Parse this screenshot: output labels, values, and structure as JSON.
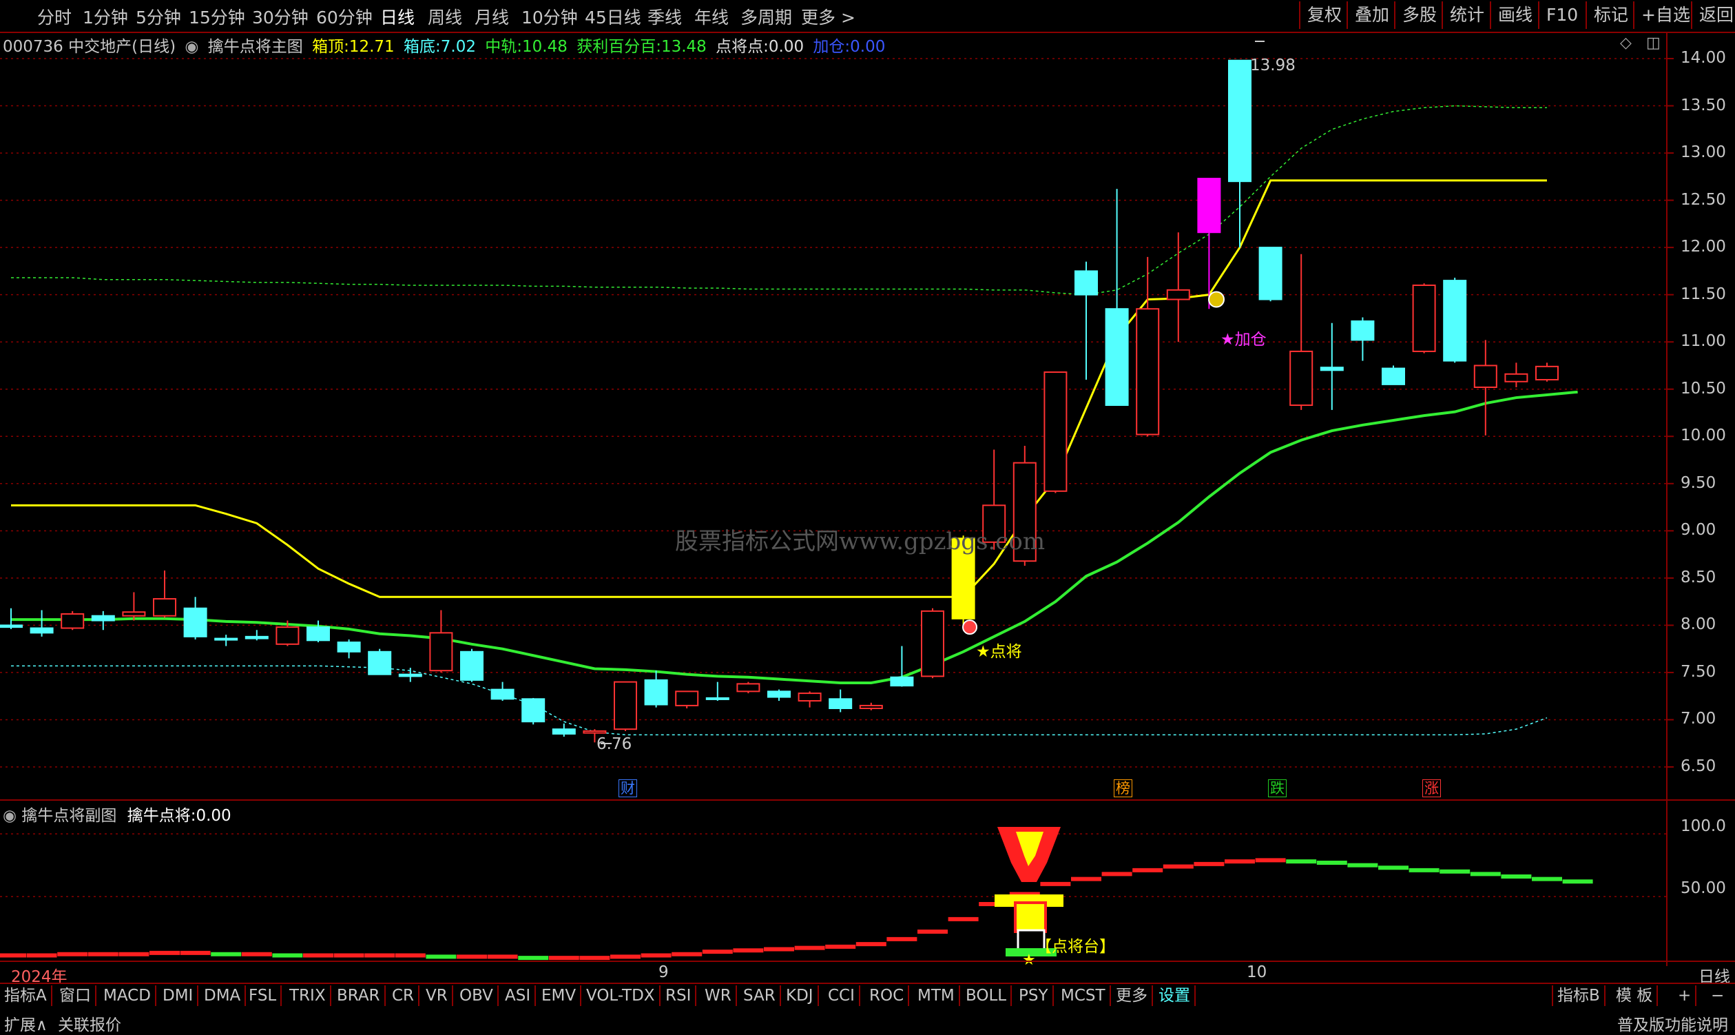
{
  "topbar": {
    "periods": [
      "分时",
      "1分钟",
      "5分钟",
      "15分钟",
      "30分钟",
      "60分钟",
      "日线",
      "周线",
      "月线",
      "10分钟",
      "45日线",
      "季线",
      "年线",
      "多周期",
      "更多 >"
    ],
    "active_period": "日线",
    "right_buttons": [
      "复权",
      "叠加",
      "多股",
      "统计",
      "画线",
      "F10",
      "标记",
      "+自选",
      "返回"
    ]
  },
  "info": {
    "stock": "000736 中交地产(日线)",
    "indicator": "擒牛点将主图",
    "box_top_label": "箱顶:",
    "box_top": "12.71",
    "box_bottom_label": "箱底:",
    "box_bottom": "7.02",
    "mid_label": "中轨:",
    "mid": "10.48",
    "profit_label": "获利百分百:",
    "profit": "13.48",
    "point_label": "点将点:",
    "point": "0.00",
    "add_label": "加仓:",
    "add": "0.00"
  },
  "price_axis": [
    "14.00",
    "13.50",
    "13.00",
    "12.50",
    "12.00",
    "11.50",
    "11.00",
    "10.50",
    "10.00",
    "9.50",
    "9.00",
    "8.50",
    "8.00",
    "7.50",
    "7.00",
    "6.50"
  ],
  "annotations": {
    "high": "13.98",
    "low": "6.76",
    "dianjiang": "★点将",
    "jiacang": "★加仓",
    "watermark": "股票指标公式网www.gpzbgs.com",
    "dianjiangtai": "【点将台】"
  },
  "markers": [
    {
      "label": "财",
      "color": "#3a78ff"
    },
    {
      "label": "榜",
      "color": "#ff9900"
    },
    {
      "label": "跌",
      "color": "#22cc22"
    },
    {
      "label": "涨",
      "color": "#ff3333"
    }
  ],
  "sub": {
    "title": "擒牛点将副图",
    "value_label": "擒牛点将:",
    "value": "0.00",
    "axis": [
      "100.0",
      "50.00"
    ]
  },
  "time_axis": [
    "2024年",
    "9",
    "10"
  ],
  "period_label": "日线",
  "indicators": [
    "指标A",
    "窗口",
    "MACD",
    "DMI",
    "DMA",
    "FSL",
    "TRIX",
    "BRAR",
    "CR",
    "VR",
    "OBV",
    "ASI",
    "EMV",
    "VOL-TDX",
    "RSI",
    "WR",
    "SAR",
    "KDJ",
    "CCI",
    "ROC",
    "MTM",
    "BOLL",
    "PSY",
    "MCST",
    "更多",
    "设置"
  ],
  "indicators_right": [
    "指标B",
    "模 板",
    "+",
    "−"
  ],
  "status": {
    "expand": "扩展∧",
    "related": "关联报价",
    "right": "普及版功能说明"
  },
  "colors": {
    "up": "#ff3232",
    "down": "#54ffff",
    "yellow": "#ffff00",
    "green": "#33ee33",
    "magenta": "#ff00ff",
    "grid": "#8b0000"
  },
  "chart_data": {
    "type": "candlestick",
    "ylim": [
      6.3,
      14.2
    ],
    "candles": [
      {
        "o": 8.0,
        "h": 8.18,
        "l": 7.96,
        "c": 7.98
      },
      {
        "o": 7.97,
        "h": 8.16,
        "l": 7.88,
        "c": 7.92
      },
      {
        "o": 7.97,
        "h": 8.15,
        "l": 7.95,
        "c": 8.12
      },
      {
        "o": 8.1,
        "h": 8.15,
        "l": 7.95,
        "c": 8.05
      },
      {
        "o": 8.1,
        "h": 8.35,
        "l": 8.05,
        "c": 8.14
      },
      {
        "o": 8.1,
        "h": 8.58,
        "l": 8.08,
        "c": 8.28
      },
      {
        "o": 8.18,
        "h": 8.3,
        "l": 7.85,
        "c": 7.88
      },
      {
        "o": 7.86,
        "h": 7.9,
        "l": 7.78,
        "c": 7.85
      },
      {
        "o": 7.88,
        "h": 7.95,
        "l": 7.84,
        "c": 7.86
      },
      {
        "o": 7.8,
        "h": 8.05,
        "l": 7.78,
        "c": 7.98
      },
      {
        "o": 7.98,
        "h": 8.05,
        "l": 7.82,
        "c": 7.84
      },
      {
        "o": 7.82,
        "h": 7.85,
        "l": 7.65,
        "c": 7.72
      },
      {
        "o": 7.72,
        "h": 7.75,
        "l": 7.48,
        "c": 7.48
      },
      {
        "o": 7.48,
        "h": 7.55,
        "l": 7.4,
        "c": 7.46
      },
      {
        "o": 7.52,
        "h": 8.16,
        "l": 7.5,
        "c": 7.92
      },
      {
        "o": 7.72,
        "h": 7.75,
        "l": 7.4,
        "c": 7.42
      },
      {
        "o": 7.32,
        "h": 7.4,
        "l": 7.2,
        "c": 7.22
      },
      {
        "o": 7.22,
        "h": 7.23,
        "l": 6.95,
        "c": 6.98
      },
      {
        "o": 6.9,
        "h": 6.96,
        "l": 6.82,
        "c": 6.85
      },
      {
        "o": 6.86,
        "h": 6.9,
        "l": 6.76,
        "c": 6.88
      },
      {
        "o": 6.9,
        "h": 7.4,
        "l": 6.88,
        "c": 7.4
      },
      {
        "o": 7.42,
        "h": 7.52,
        "l": 7.13,
        "c": 7.16
      },
      {
        "o": 7.15,
        "h": 7.3,
        "l": 7.12,
        "c": 7.3
      },
      {
        "o": 7.23,
        "h": 7.4,
        "l": 7.2,
        "c": 7.22
      },
      {
        "o": 7.3,
        "h": 7.4,
        "l": 7.28,
        "c": 7.38
      },
      {
        "o": 7.3,
        "h": 7.32,
        "l": 7.2,
        "c": 7.24
      },
      {
        "o": 7.2,
        "h": 7.3,
        "l": 7.13,
        "c": 7.28
      },
      {
        "o": 7.22,
        "h": 7.32,
        "l": 7.08,
        "c": 7.12
      },
      {
        "o": 7.12,
        "h": 7.18,
        "l": 7.1,
        "c": 7.15
      },
      {
        "o": 7.45,
        "h": 7.78,
        "l": 7.35,
        "c": 7.36
      },
      {
        "o": 7.46,
        "h": 8.18,
        "l": 7.44,
        "c": 8.15
      },
      {
        "o": 8.07,
        "h": 8.95,
        "l": 8.0,
        "c": 8.92,
        "limit": "yellow"
      },
      {
        "o": 8.88,
        "h": 9.86,
        "l": 8.8,
        "c": 9.27
      },
      {
        "o": 8.68,
        "h": 9.9,
        "l": 8.63,
        "c": 9.72
      },
      {
        "o": 9.42,
        "h": 10.2,
        "l": 9.4,
        "c": 10.68
      },
      {
        "o": 11.75,
        "h": 11.85,
        "l": 10.6,
        "c": 11.5
      },
      {
        "o": 11.35,
        "h": 12.62,
        "l": 10.8,
        "c": 10.33
      },
      {
        "o": 10.02,
        "h": 11.9,
        "l": 10.0,
        "c": 11.35
      },
      {
        "o": 11.45,
        "h": 12.16,
        "l": 11.0,
        "c": 11.55
      },
      {
        "o": 12.16,
        "h": 12.73,
        "l": 11.35,
        "c": 12.73,
        "limit": "magenta"
      },
      {
        "o": 13.98,
        "h": 13.98,
        "l": 12.0,
        "c": 12.7
      },
      {
        "o": 12.0,
        "h": 12.0,
        "l": 11.43,
        "c": 11.45
      },
      {
        "o": 10.33,
        "h": 11.93,
        "l": 10.28,
        "c": 10.9
      },
      {
        "o": 10.73,
        "h": 11.2,
        "l": 10.28,
        "c": 10.7
      },
      {
        "o": 11.22,
        "h": 11.26,
        "l": 10.8,
        "c": 11.02
      },
      {
        "o": 10.72,
        "h": 10.75,
        "l": 10.55,
        "c": 10.55
      },
      {
        "o": 10.9,
        "h": 11.62,
        "l": 10.88,
        "c": 11.6
      },
      {
        "o": 11.65,
        "h": 11.68,
        "l": 10.78,
        "c": 10.8
      },
      {
        "o": 10.52,
        "h": 11.02,
        "l": 10.01,
        "c": 10.75
      },
      {
        "o": 10.58,
        "h": 10.78,
        "l": 10.52,
        "c": 10.66
      },
      {
        "o": 10.6,
        "h": 10.78,
        "l": 10.58,
        "c": 10.74
      }
    ],
    "ma_green": [
      8.06,
      8.06,
      8.06,
      8.06,
      8.07,
      8.07,
      8.06,
      8.04,
      8.03,
      8.01,
      7.99,
      7.96,
      7.91,
      7.89,
      7.86,
      7.8,
      7.75,
      7.68,
      7.61,
      7.54,
      7.53,
      7.51,
      7.48,
      7.46,
      7.45,
      7.43,
      7.41,
      7.39,
      7.39,
      7.45,
      7.58,
      7.72,
      7.88,
      8.04,
      8.25,
      8.52,
      8.67,
      8.87,
      9.09,
      9.36,
      9.61,
      9.83,
      9.96,
      10.06,
      10.12,
      10.17,
      10.22,
      10.26,
      10.35,
      10.41,
      10.44,
      10.47
    ],
    "box_top": [
      9.27,
      9.27,
      9.27,
      9.27,
      9.27,
      9.27,
      9.27,
      9.18,
      9.08,
      8.85,
      8.6,
      8.44,
      8.3,
      8.3,
      8.3,
      8.3,
      8.3,
      8.3,
      8.3,
      8.3,
      8.3,
      8.3,
      8.3,
      8.3,
      8.3,
      8.3,
      8.3,
      8.3,
      8.3,
      8.3,
      8.3,
      8.3,
      8.65,
      9.14,
      9.55,
      10.3,
      11.05,
      11.45,
      11.46,
      11.5,
      12.0,
      12.71,
      12.71,
      12.71,
      12.71,
      12.71,
      12.71,
      12.71,
      12.71,
      12.71,
      12.71
    ],
    "upper_dotted": [
      11.68,
      11.68,
      11.68,
      11.66,
      11.66,
      11.66,
      11.65,
      11.64,
      11.63,
      11.63,
      11.62,
      11.61,
      11.61,
      11.6,
      11.6,
      11.6,
      11.6,
      11.59,
      11.59,
      11.58,
      11.58,
      11.58,
      11.57,
      11.57,
      11.56,
      11.56,
      11.56,
      11.56,
      11.56,
      11.56,
      11.56,
      11.56,
      11.55,
      11.55,
      11.52,
      11.5,
      11.55,
      11.72,
      11.94,
      12.14,
      12.43,
      12.75,
      13.05,
      13.25,
      13.36,
      13.44,
      13.48,
      13.5,
      13.49,
      13.48,
      13.48
    ],
    "lower_dotted": [
      7.57,
      7.57,
      7.57,
      7.57,
      7.57,
      7.57,
      7.57,
      7.57,
      7.57,
      7.57,
      7.57,
      7.56,
      7.55,
      7.52,
      7.45,
      7.38,
      7.27,
      7.16,
      6.98,
      6.87,
      6.84,
      6.84,
      6.84,
      6.84,
      6.84,
      6.84,
      6.84,
      6.84,
      6.84,
      6.84,
      6.84,
      6.84,
      6.84,
      6.84,
      6.84,
      6.84,
      6.84,
      6.84,
      6.84,
      6.84,
      6.84,
      6.84,
      6.84,
      6.84,
      6.84,
      6.84,
      6.84,
      6.84,
      6.85,
      6.9,
      7.02
    ],
    "sub_values": [
      2,
      3,
      3,
      4,
      4,
      4,
      5,
      5,
      4,
      4,
      3,
      3,
      3,
      3,
      3,
      2,
      2,
      2,
      1,
      1,
      1,
      2,
      3,
      4,
      6,
      7,
      8,
      9,
      10,
      12,
      16,
      22,
      32,
      44,
      52,
      60,
      64,
      68,
      71,
      74,
      76,
      78,
      79,
      78,
      77,
      75,
      73,
      71,
      70,
      68,
      66,
      64,
      62
    ],
    "sub_ylim": [
      0,
      110
    ]
  }
}
